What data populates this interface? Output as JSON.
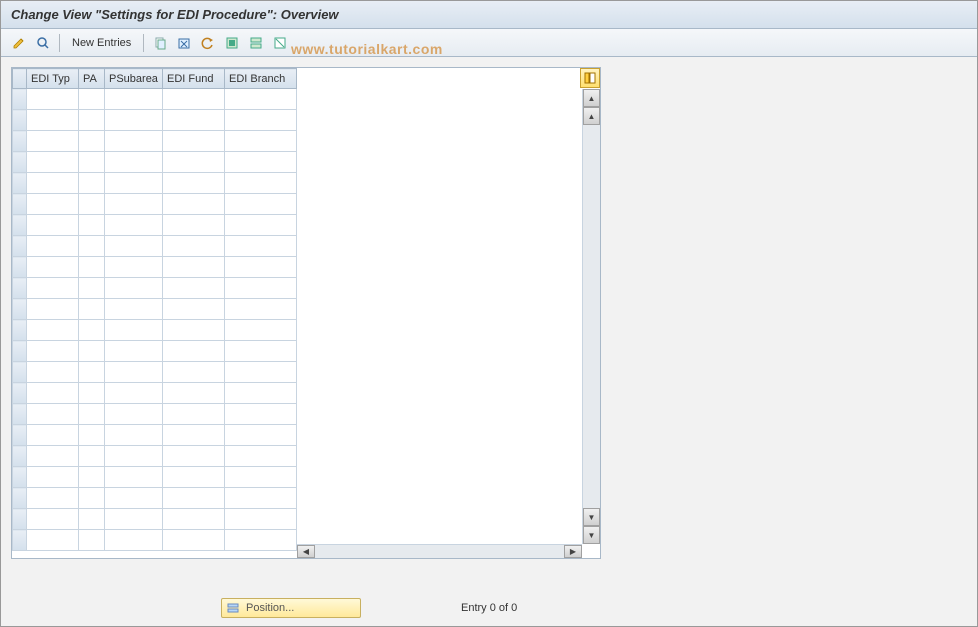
{
  "title": "Change View \"Settings for EDI Procedure\": Overview",
  "toolbar": {
    "new_entries_label": "New Entries"
  },
  "watermark": "www.tutorialkart.com",
  "table": {
    "columns": [
      "EDI Typ",
      "PA",
      "PSubarea",
      "EDI Fund",
      "EDI Branch"
    ],
    "row_count": 22,
    "rows": []
  },
  "footer": {
    "position_label": "Position...",
    "entry_status": "Entry 0 of 0"
  }
}
